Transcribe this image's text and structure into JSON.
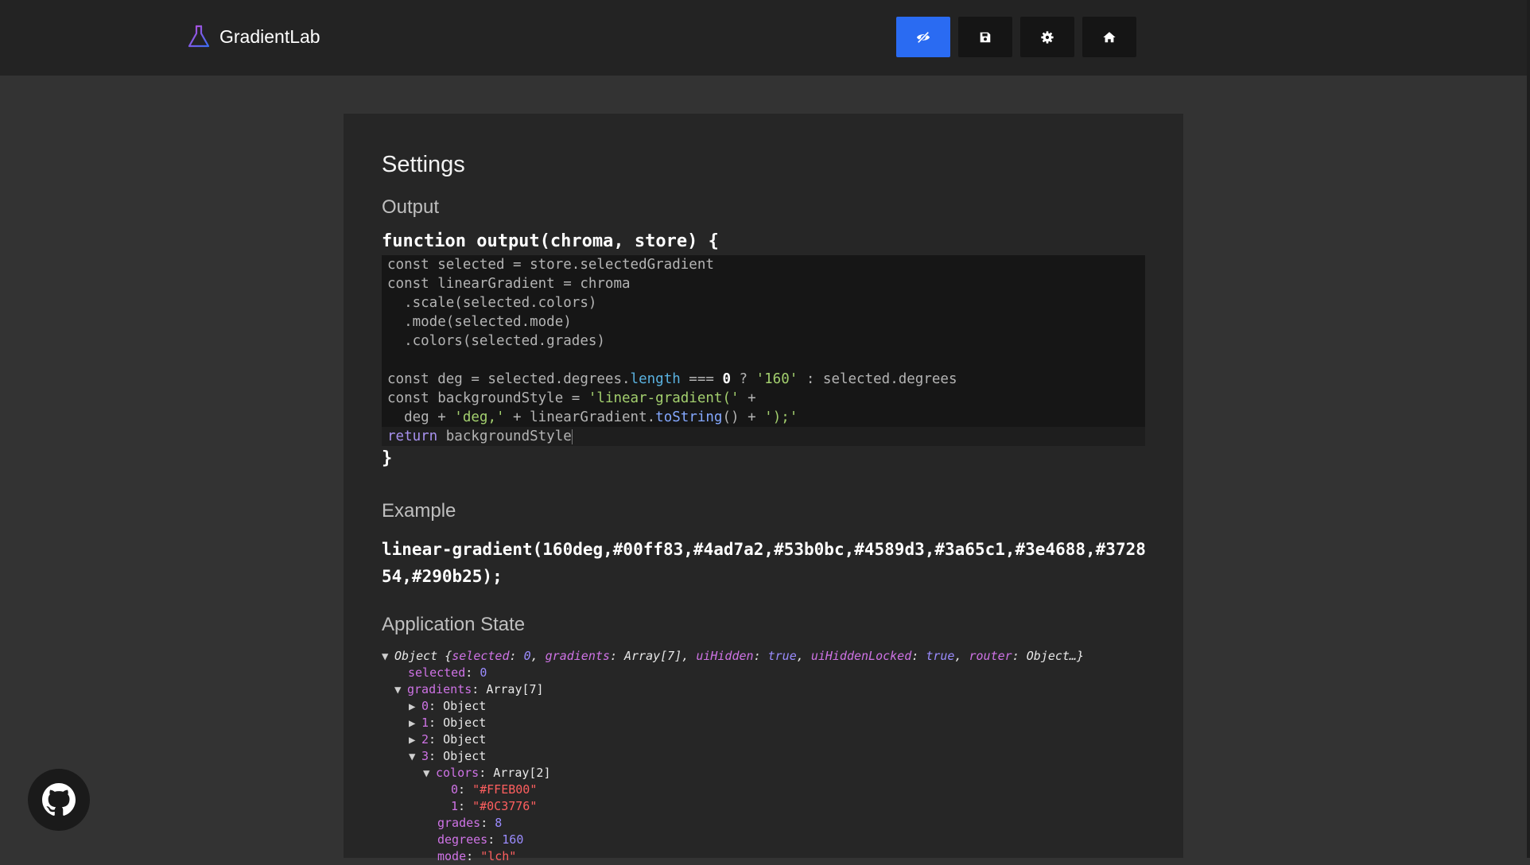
{
  "header": {
    "app_name": "GradientLab",
    "buttons": [
      {
        "icon": "eye-slash-icon",
        "active": true
      },
      {
        "icon": "save-icon",
        "active": false
      },
      {
        "icon": "gear-icon",
        "active": false
      },
      {
        "icon": "home-icon",
        "active": false
      }
    ]
  },
  "settings": {
    "title": "Settings",
    "output_heading": "Output",
    "fn_open": "function output(chroma, store) {",
    "fn_close": "}",
    "code": {
      "l1": "const selected = store.selectedGradient",
      "l2": "const linearGradient = chroma",
      "l3": "  .scale(selected.colors)",
      "l4": "  .mode(selected.mode)",
      "l5": "  .colors(selected.grades)",
      "l7a": "const deg = selected.degrees.",
      "l7b": "length",
      "l7c": " === ",
      "l7d": "0",
      "l7e": " ? ",
      "l7f": "'160'",
      "l7g": " : selected.degrees",
      "l8a": "const backgroundStyle = ",
      "l8b": "'linear-gradient('",
      "l8c": " +",
      "l9a": "  deg + ",
      "l9b": "'deg,'",
      "l9c": " + linearGradient.",
      "l9d": "toString",
      "l9e": "() + ",
      "l9f": "');'",
      "l10a": "return",
      "l10b": " backgroundStyle"
    },
    "example_heading": "Example",
    "example_value": "linear-gradient(160deg,#00ff83,#4ad7a2,#53b0bc,#4589d3,#3a65c1,#3e4688,#372854,#290b25);",
    "state_heading": "Application State"
  },
  "state_tree": {
    "root_label": "Object",
    "root_summary": {
      "open": " {",
      "k1": "selected",
      "v1": "0",
      "k2": "gradients",
      "v2": "Array[7]",
      "k3": "uiHidden",
      "v3": "true",
      "k4": "uiHiddenLocked",
      "v4": "true",
      "k5": "router",
      "v5": "Object…}"
    },
    "selected_key": "selected",
    "selected_val": "0",
    "gradients_key": "gradients",
    "gradients_val": "Array[7]",
    "items": [
      {
        "key": "0",
        "val": "Object"
      },
      {
        "key": "1",
        "val": "Object"
      },
      {
        "key": "2",
        "val": "Object"
      },
      {
        "key": "3",
        "val": "Object"
      }
    ],
    "colors_key": "colors",
    "colors_val": "Array[2]",
    "color_items": [
      {
        "key": "0",
        "val": "\"#FFEB00\""
      },
      {
        "key": "1",
        "val": "\"#0C3776\""
      }
    ],
    "grades_key": "grades",
    "grades_val": "8",
    "degrees_key": "degrees",
    "degrees_val": "160",
    "mode_key": "mode",
    "mode_val": "\"lch\""
  },
  "footer": {
    "github_icon": "github-icon"
  }
}
